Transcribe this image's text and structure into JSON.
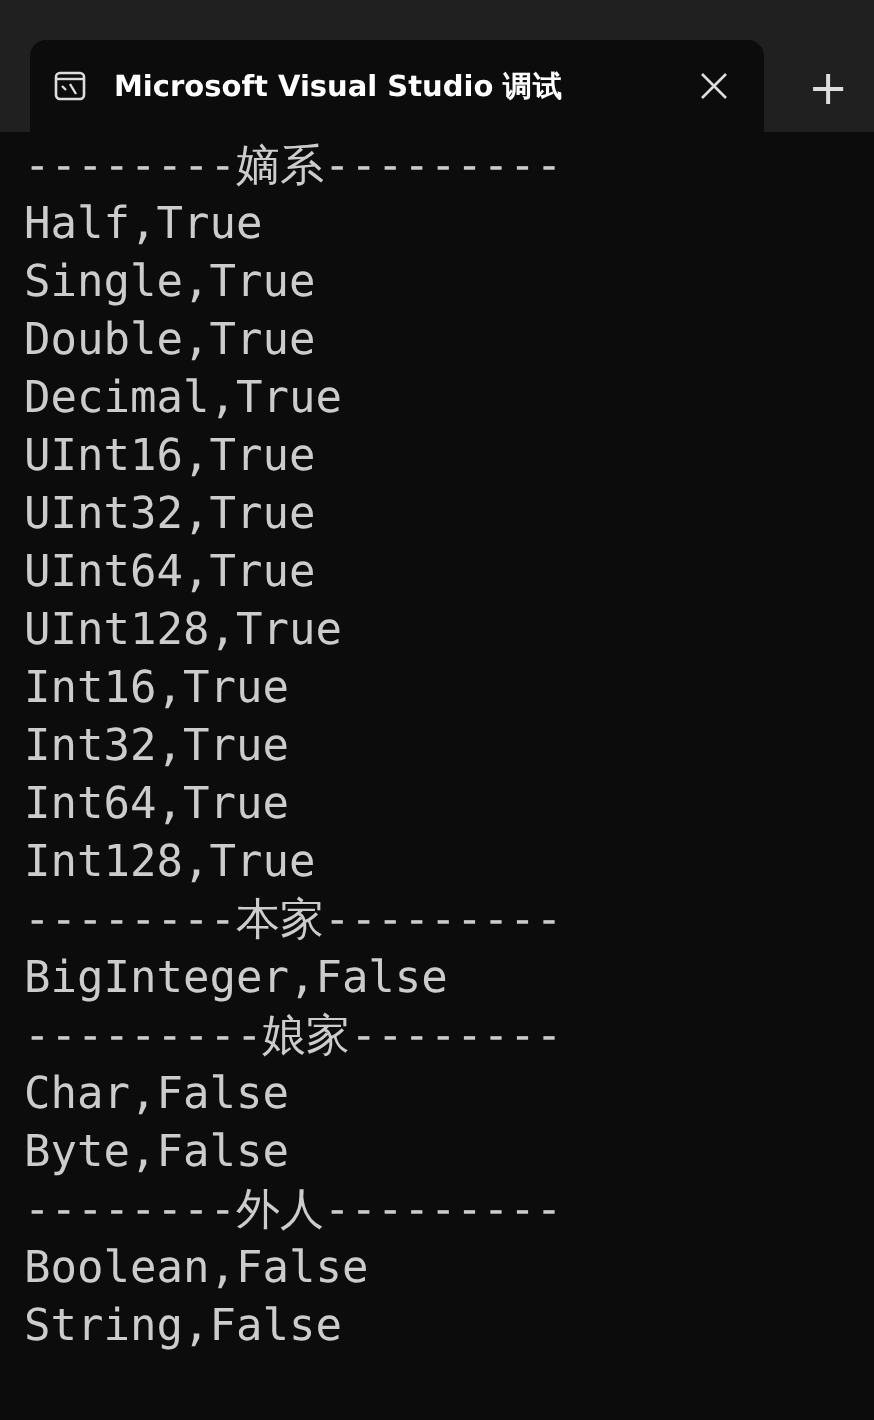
{
  "tab": {
    "title": "Microsoft Visual Studio 调试",
    "selected": true
  },
  "new_tab": "+",
  "console_lines": [
    "--------嫡系---------",
    "Half,True",
    "Single,True",
    "Double,True",
    "Decimal,True",
    "UInt16,True",
    "UInt32,True",
    "UInt64,True",
    "UInt128,True",
    "Int16,True",
    "Int32,True",
    "Int64,True",
    "Int128,True",
    "--------本家---------",
    "BigInteger,False",
    "---------娘家--------",
    "Char,False",
    "Byte,False",
    "--------外人---------",
    "Boolean,False",
    "String,False"
  ]
}
